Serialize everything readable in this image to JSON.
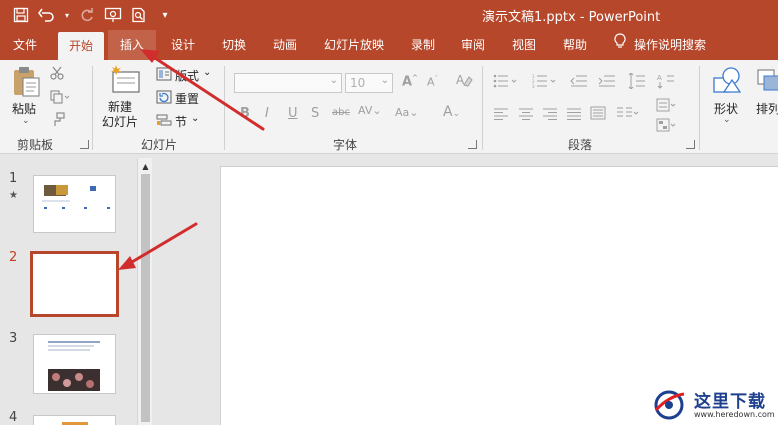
{
  "window": {
    "title": "演示文稿1.pptx  -  PowerPoint"
  },
  "qat": {
    "icons": [
      "save-icon",
      "undo-icon",
      "redo-icon",
      "slideshow-icon",
      "print-preview-icon",
      "customize-icon"
    ]
  },
  "tabs": [
    "文件",
    "开始",
    "插入",
    "设计",
    "切换",
    "动画",
    "幻灯片放映",
    "录制",
    "审阅",
    "视图",
    "帮助"
  ],
  "active_tab": "开始",
  "tell_me": "操作说明搜索",
  "ribbon": {
    "paste": "粘贴",
    "clipboard": "剪贴板",
    "new_slide": "新建\n幻灯片",
    "layout": "版式",
    "reset": "重置",
    "section": "节",
    "slides": "幻灯片",
    "font_size": "10",
    "font_group": "字体",
    "paragraph_group": "段落",
    "shapes": "形状",
    "arrange": "排列"
  },
  "slides": [
    {
      "number": "1",
      "has_animation": true
    },
    {
      "number": "2",
      "selected": true
    },
    {
      "number": "3"
    },
    {
      "number": "4"
    }
  ],
  "watermark": {
    "name": "这里下载",
    "url": "www.heredown.com"
  },
  "colors": {
    "accent": "#b7472a",
    "selection": "#b7472a",
    "annotation_arrow": "#d22d2d"
  }
}
